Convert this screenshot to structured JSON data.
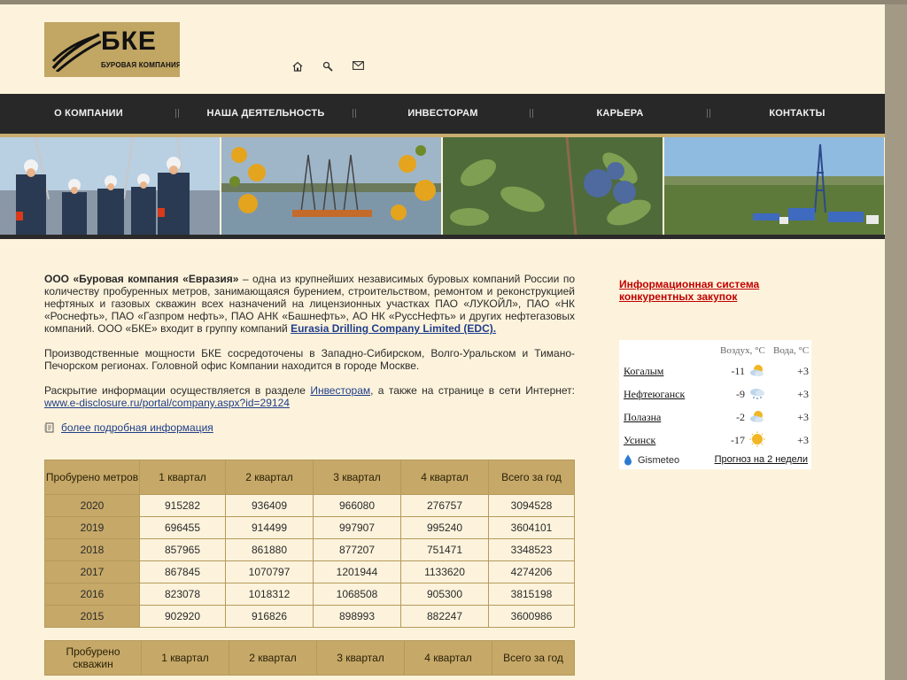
{
  "logo": {
    "title": "БКЕ",
    "subtitle": "БУРОВАЯ КОМПАНИЯ"
  },
  "header_icons": [
    "home-icon",
    "search-icon",
    "mail-icon"
  ],
  "nav": [
    "О КОМПАНИИ",
    "НАША ДЕЯТЕЛЬНОСТЬ",
    "ИНВЕСТОРАМ",
    "КАРЬЕРА",
    "КОНТАКТЫ"
  ],
  "intro": {
    "company": "ООО «Буровая компания «Евразия»",
    "text1": " – одна из крупнейших независимых буровых компаний России по количеству пробуренных метров, занимающаяся бурением, строительством, ремонтом и реконструкцией нефтяных и газовых скважин всех назначений на лицензионных участках ПАО «ЛУКОЙЛ», ПАО «НК «Роснефть», ПАО «Газпром нефть», ПАО АНК «Башнефть», АО НК «РуссНефть» и других нефтегазовых компаний. ООО «БКЕ» входит в группу компаний ",
    "edc_link": "Eurasia Drilling Company Limited (EDC).",
    "para2": "Производственные мощности БКЕ сосредоточены в Западно-Сибирском, Волго-Уральском и Тимано-Печорском регионах. Головной офис Компании находится в городе Москве.",
    "para3_start": "Раскрытие информации осуществляется в разделе ",
    "investors_link": "Инвесторам",
    "para3_mid": ", а также на странице в сети Интернет: ",
    "disclosure_link": "www.e-disclosure.ru/portal/company.aspx?id=29124",
    "more_link": "более подробная информация"
  },
  "meters_table": {
    "header": [
      "Пробурено метров",
      "1 квартал",
      "2 квартал",
      "3 квартал",
      "4 квартал",
      "Всего за год"
    ],
    "rows": [
      [
        "2020",
        "915282",
        "936409",
        "966080",
        "276757",
        "3094528"
      ],
      [
        "2019",
        "696455",
        "914499",
        "997907",
        "995240",
        "3604101"
      ],
      [
        "2018",
        "857965",
        "861880",
        "877207",
        "751471",
        "3348523"
      ],
      [
        "2017",
        "867845",
        "1070797",
        "1201944",
        "1133620",
        "4274206"
      ],
      [
        "2016",
        "823078",
        "1018312",
        "1068508",
        "905300",
        "3815198"
      ],
      [
        "2015",
        "902920",
        "916826",
        "898993",
        "882247",
        "3600986"
      ]
    ]
  },
  "wells_table": {
    "header": [
      "Пробурено скважин",
      "1 квартал",
      "2 квартал",
      "3 квартал",
      "4 квартал",
      "Всего за год"
    ]
  },
  "sidebar": {
    "procurement_link": "Информационная система конкурентных закупок"
  },
  "weather": {
    "air_header": "Воздух, °С",
    "water_header": "Вода, °С",
    "rows": [
      {
        "city": "Когалым",
        "air": "-11",
        "icon": "cloud-sun-icon",
        "water": "+3"
      },
      {
        "city": "Нефтеюганск",
        "air": "-9",
        "icon": "cloud-snow-icon",
        "water": "+3"
      },
      {
        "city": "Полазна",
        "air": "-2",
        "icon": "cloud-sun-icon",
        "water": "+3"
      },
      {
        "city": "Усинск",
        "air": "-17",
        "icon": "sun-icon",
        "water": "+3"
      }
    ],
    "brand": "Gismeteo",
    "forecast_link": "Прогноз на 2 недели"
  }
}
